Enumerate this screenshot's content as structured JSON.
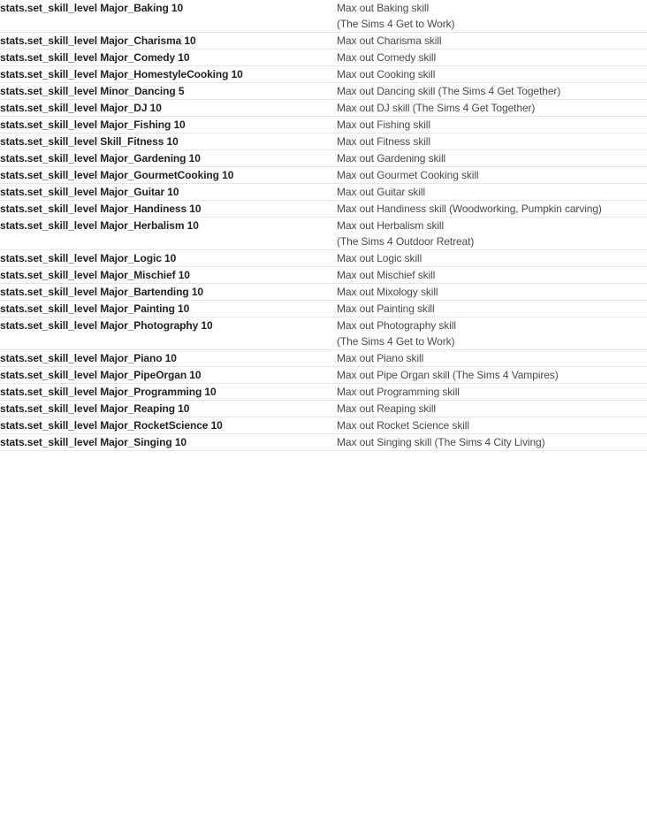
{
  "table": {
    "rows": [
      {
        "command": "stats.set_skill_level Major_Baking 10",
        "description_lines": [
          "Max out Baking skill",
          "(The Sims 4 Get to Work)"
        ]
      },
      {
        "command": "stats.set_skill_level Major_Charisma 10",
        "description_lines": [
          "Max out Charisma skill"
        ]
      },
      {
        "command": "stats.set_skill_level Major_Comedy 10",
        "description_lines": [
          "Max out Comedy skill"
        ]
      },
      {
        "command": "stats.set_skill_level Major_HomestyleCooking 10",
        "description_lines": [
          "Max out Cooking skill"
        ]
      },
      {
        "command": "stats.set_skill_level Minor_Dancing 5",
        "description_lines": [
          "Max out Dancing skill (The Sims 4 Get Together)"
        ]
      },
      {
        "command": "stats.set_skill_level Major_DJ 10",
        "description_lines": [
          "Max out DJ skill (The Sims 4 Get Together)"
        ]
      },
      {
        "command": "stats.set_skill_level Major_Fishing 10",
        "description_lines": [
          "Max out Fishing skill"
        ]
      },
      {
        "command": "stats.set_skill_level Skill_Fitness 10",
        "description_lines": [
          "Max out Fitness skill"
        ]
      },
      {
        "command": "stats.set_skill_level Major_Gardening 10",
        "description_lines": [
          "Max out Gardening skill"
        ]
      },
      {
        "command": "stats.set_skill_level Major_GourmetCooking 10",
        "description_lines": [
          "Max out Gourmet Cooking skill"
        ]
      },
      {
        "command": "stats.set_skill_level Major_Guitar 10",
        "description_lines": [
          "Max out Guitar skill"
        ]
      },
      {
        "command": "stats.set_skill_level Major_Handiness 10",
        "description_lines": [
          "Max out Handiness skill (Woodworking, Pumpkin carving)"
        ]
      },
      {
        "command": "stats.set_skill_level Major_Herbalism 10",
        "description_lines": [
          "Max out Herbalism skill",
          "(The Sims 4 Outdoor Retreat)"
        ]
      },
      {
        "command": "stats.set_skill_level Major_Logic 10",
        "description_lines": [
          "Max out Logic skill"
        ]
      },
      {
        "command": "stats.set_skill_level Major_Mischief 10",
        "description_lines": [
          "Max out Mischief skill"
        ]
      },
      {
        "command": "stats.set_skill_level Major_Bartending 10",
        "description_lines": [
          "Max out Mixology skill"
        ]
      },
      {
        "command": "stats.set_skill_level Major_Painting 10",
        "description_lines": [
          "Max out Painting skill"
        ]
      },
      {
        "command": "stats.set_skill_level Major_Photography 10",
        "description_lines": [
          "Max out Photography skill",
          "(The Sims 4 Get to Work)"
        ]
      },
      {
        "command": "stats.set_skill_level Major_Piano 10",
        "description_lines": [
          "Max out Piano skill"
        ]
      },
      {
        "command": "stats.set_skill_level Major_PipeOrgan 10",
        "description_lines": [
          "Max out Pipe Organ skill (The Sims 4 Vampires)"
        ]
      },
      {
        "command": "stats.set_skill_level Major_Programming 10",
        "description_lines": [
          "Max out Programming skill"
        ]
      },
      {
        "command": "stats.set_skill_level Major_Reaping 10",
        "description_lines": [
          "Max out Reaping skill"
        ]
      },
      {
        "command": "stats.set_skill_level Major_RocketScience 10",
        "description_lines": [
          "Max out Rocket Science skill"
        ]
      },
      {
        "command": "stats.set_skill_level Major_Singing 10",
        "description_lines": [
          "Max out Singing skill (The Sims 4 City Living)"
        ]
      }
    ]
  },
  "colors": {
    "page_background": "#ffffff",
    "command_text": "#222222",
    "description_text": "#4a4a4a",
    "row_divider": "#e6e6e6"
  }
}
